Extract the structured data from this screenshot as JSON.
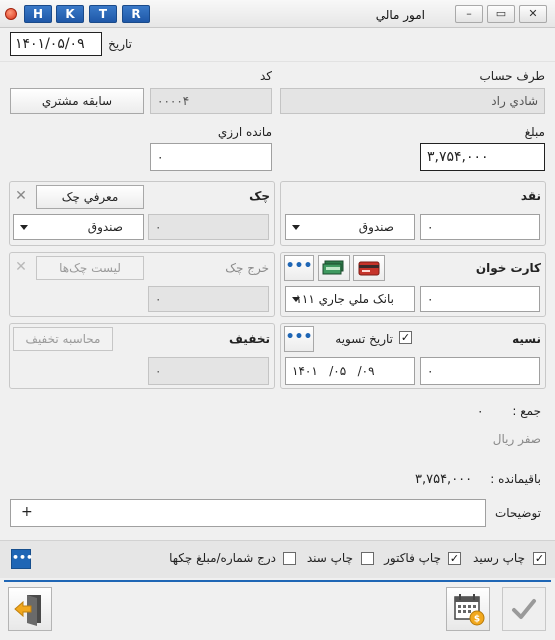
{
  "window": {
    "title": "امور مالي",
    "hotkeys": [
      "H",
      "K",
      "T",
      "R"
    ],
    "minimize_glyph": "–",
    "restore_glyph": "▭",
    "close_glyph": "✕"
  },
  "header": {
    "date_label": "تاريخ",
    "date_value": "۱۴۰۱/۰۵/۰۹"
  },
  "party": {
    "label": "طرف حساب",
    "value": "شادي راد",
    "code_label": "کد",
    "code_value": "۰۰۰۰۴",
    "history_button": "سابقه مشتري"
  },
  "amount": {
    "label": "مبلغ",
    "value": "۳,۷۵۴,۰۰۰",
    "fx_balance_label": "مانده ارزي",
    "fx_balance_value": "۰"
  },
  "cash": {
    "label": "نقد",
    "amount": "۰",
    "account": "صندوق"
  },
  "cheque": {
    "label": "چک",
    "intro_button": "معرفي چک",
    "amount": "۰",
    "account": "صندوق",
    "close_glyph": "✕"
  },
  "card": {
    "label": "کارت خوان",
    "amount": "۰",
    "account": "بانک ملي جاري ۱۱۱",
    "more_button": "•••"
  },
  "cheque_out": {
    "label": "خرج چک",
    "list_button": "ليست چک‌ها",
    "amount": "۰",
    "close_glyph": "✕"
  },
  "credit": {
    "label": "نسيه",
    "settle_date_label": "تاريخ تسويه",
    "settle_date_checked": true,
    "amount": "۰",
    "settle_date_value": "۱۴۰۱   /۰۵   /۰۹",
    "more_button": "•••"
  },
  "discount": {
    "label": "تخفيف",
    "calc_button": "محاسبه تخفيف",
    "amount": "۰"
  },
  "totals": {
    "sum_label": "جمع :",
    "sum_value": "۰",
    "sum_words": "صفر ريال",
    "remaining_label": "باقيمانده :",
    "remaining_value": "۳,۷۵۴,۰۰۰"
  },
  "notes": {
    "label": "توضيحات",
    "add_glyph": "+"
  },
  "options": {
    "print_receipt": {
      "label": "چاپ رسيد",
      "checked": true
    },
    "print_invoice": {
      "label": "چاپ فاکتور",
      "checked": true
    },
    "print_voucher": {
      "label": "چاپ سند",
      "checked": false
    },
    "insert_cheque": {
      "label": "درج شماره/مبلغ چکها",
      "checked": false
    },
    "more_button": "•••"
  },
  "colors": {
    "accent": "#1f66b5",
    "hotkey_bg": "#2b67b8",
    "exit_arrow": "#f2a81d",
    "calendar_badge": "#f2a81d"
  }
}
